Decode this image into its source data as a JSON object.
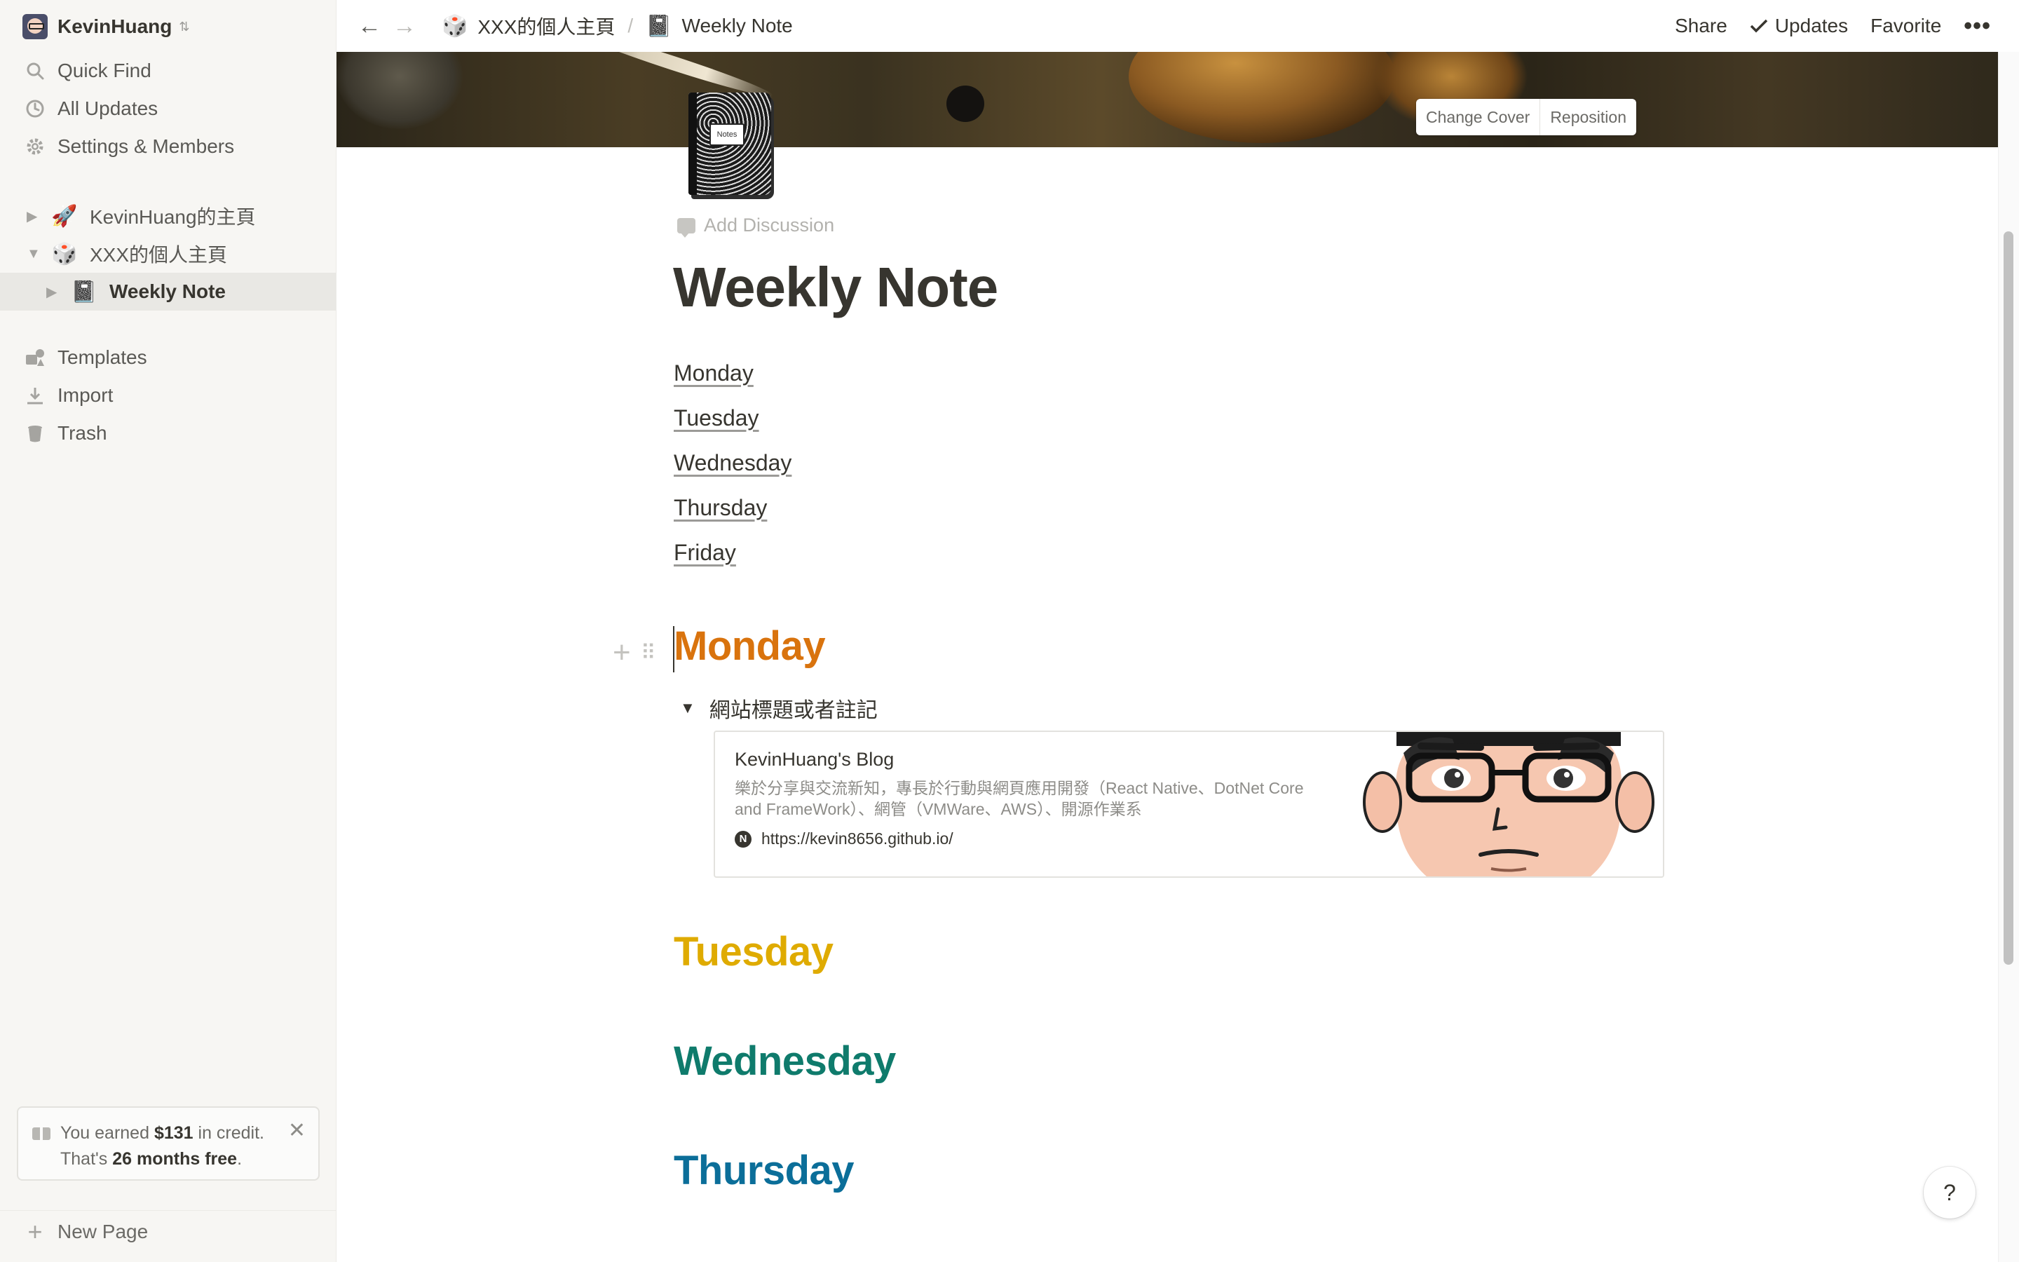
{
  "sidebar": {
    "workspace": "KevinHuang",
    "workspace_chevron": "⌃",
    "menu": [
      {
        "label": "Quick Find",
        "icon": "search-icon"
      },
      {
        "label": "All Updates",
        "icon": "clock-icon"
      },
      {
        "label": "Settings & Members",
        "icon": "gear-icon"
      }
    ],
    "pages": [
      {
        "label": "KevinHuang的主頁",
        "emoji": "🚀",
        "expand": "▶"
      },
      {
        "label": "XXX的個人主頁",
        "emoji": "🎲",
        "expand": "▼"
      }
    ],
    "subpage": {
      "label": "Weekly Note",
      "emoji": "📓",
      "expand": "▶"
    },
    "tools": [
      {
        "label": "Templates",
        "icon": "templates-icon"
      },
      {
        "label": "Import",
        "icon": "download-icon"
      },
      {
        "label": "Trash",
        "icon": "trash-icon"
      }
    ],
    "credit": {
      "prefix": "You earned ",
      "amount": "$131",
      "suffix": " in credit.",
      "line2_prefix": "That's ",
      "months": "26 months free",
      "line2_suffix": ".",
      "close": "✕"
    },
    "new_page": "New Page"
  },
  "topbar": {
    "back": "←",
    "forward": "→",
    "crumb_parent": {
      "emoji": "🎲",
      "label": "XXX的個人主頁"
    },
    "separator": "/",
    "crumb_current": {
      "emoji": "📓",
      "label": "Weekly Note"
    },
    "share": "Share",
    "updates": "Updates",
    "favorite": "Favorite",
    "more": "•••"
  },
  "cover": {
    "change_cover": "Change Cover",
    "reposition": "Reposition"
  },
  "page": {
    "icon_label": "Notes",
    "add_discussion": "Add Discussion",
    "title": "Weekly Note",
    "toc": [
      "Monday",
      "Tuesday",
      "Wednesday",
      "Thursday",
      "Friday"
    ],
    "headings": [
      {
        "text": "Monday",
        "color": "#d9730d"
      },
      {
        "text": "Tuesday",
        "color": "#dfab01"
      },
      {
        "text": "Wednesday",
        "color": "#0f7b6c"
      },
      {
        "text": "Thursday",
        "color": "#0b6e99"
      }
    ],
    "toggle": {
      "arrow": "▼",
      "label": "網站標題或者註記"
    },
    "bookmark": {
      "title": "KevinHuang's Blog",
      "description": "樂於分享與交流新知，專長於行動與網頁應用開發（React Native、DotNet Core and FrameWork）、網管（VMWare、AWS）、開源作業系",
      "favicon": "N",
      "url": "https://kevin8656.github.io/"
    }
  },
  "help": "?"
}
